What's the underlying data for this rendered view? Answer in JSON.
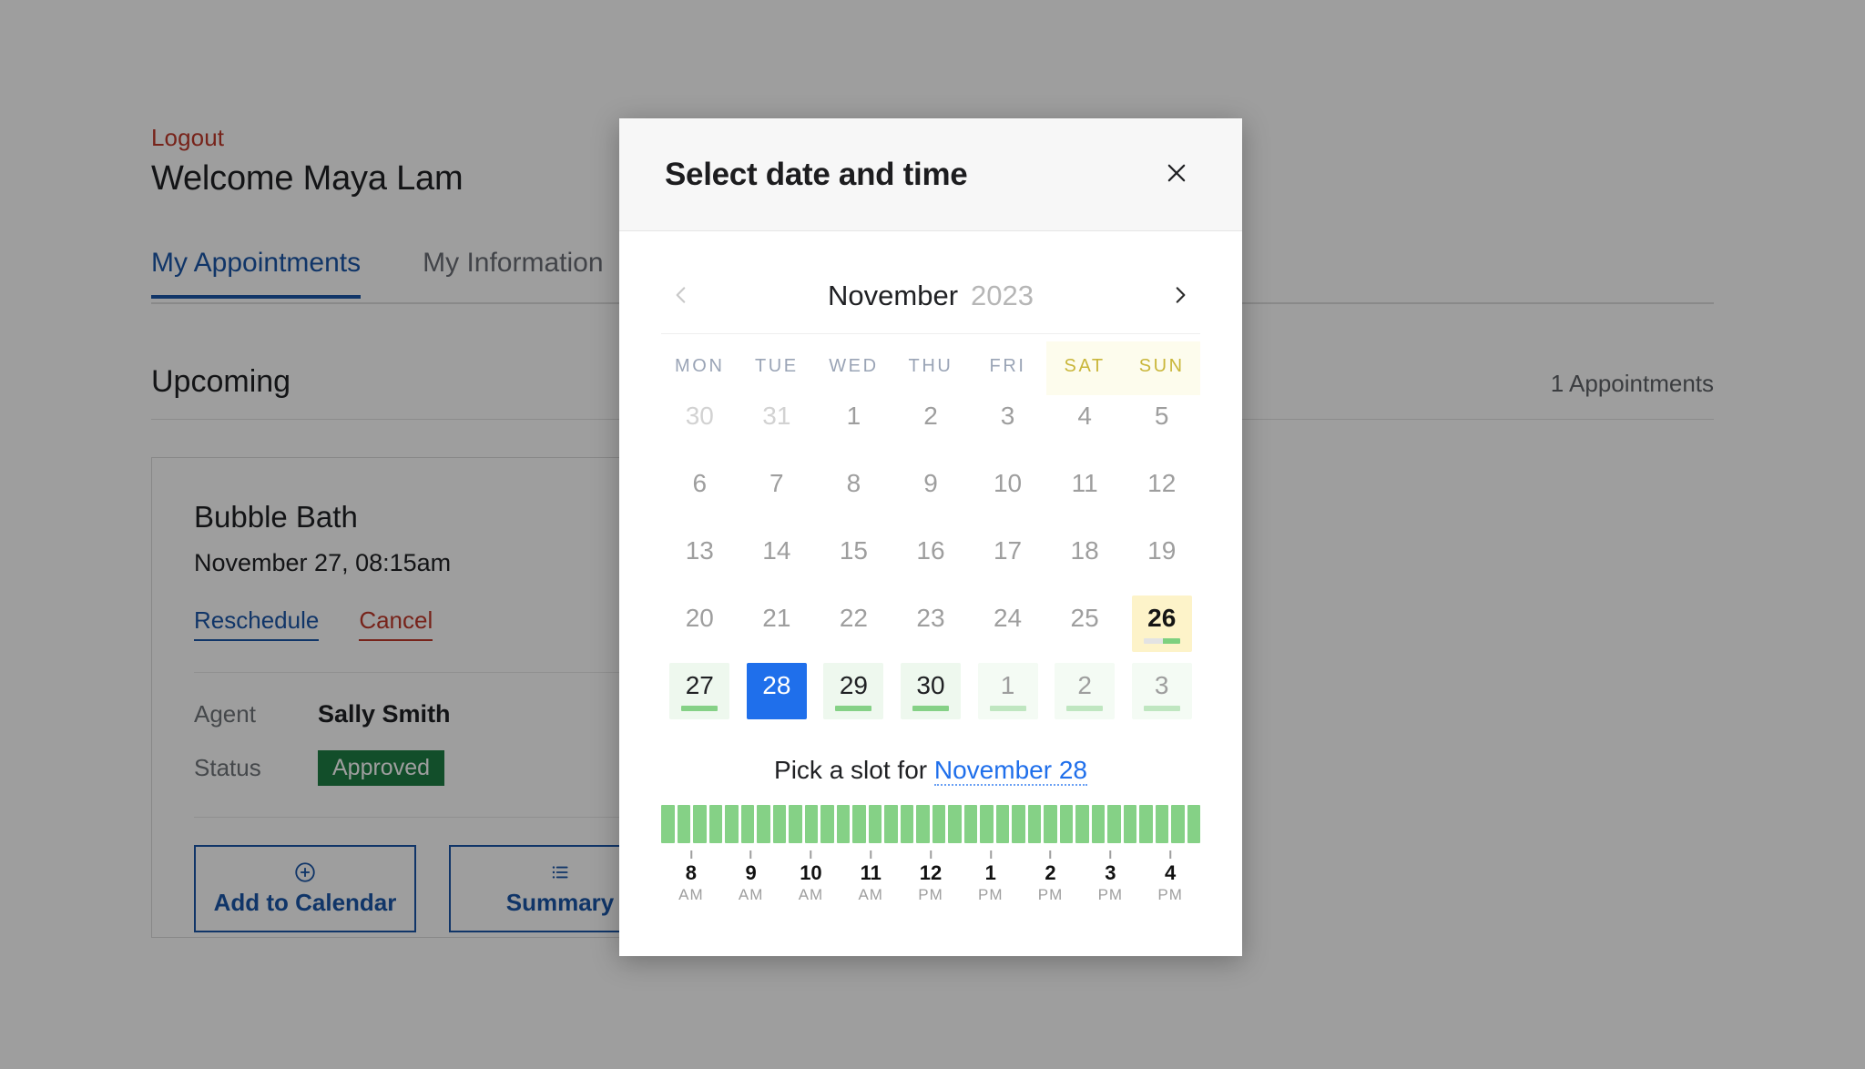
{
  "page": {
    "logout_label": "Logout",
    "welcome_title": "Welcome Maya Lam",
    "tabs": [
      {
        "label": "My Appointments",
        "active": true
      },
      {
        "label": "My Information",
        "active": false
      }
    ],
    "section": {
      "title": "Upcoming",
      "count_label": "1 Appointments"
    },
    "appointment": {
      "name": "Bubble Bath",
      "datetime": "November 27, 08:15am",
      "reschedule_label": "Reschedule",
      "cancel_label": "Cancel",
      "agent_label": "Agent",
      "agent_value": "Sally Smith",
      "status_label": "Status",
      "status_value": "Approved",
      "status_color": "#1e7e44",
      "add_to_calendar_label": "Add to Calendar",
      "add_to_calendar_icon": "plus-circle-icon",
      "summary_label": "Summary",
      "summary_icon": "list-icon"
    },
    "accent_color": "#1a56a8",
    "danger_color": "#c0392b"
  },
  "modal": {
    "title": "Select date and time",
    "close_icon": "close-icon",
    "prev_icon": "chevron-left-icon",
    "next_icon": "chevron-right-icon",
    "month_name": "November",
    "year": "2023",
    "weekdays": [
      {
        "label": "MON",
        "weekend": false
      },
      {
        "label": "TUE",
        "weekend": false
      },
      {
        "label": "WED",
        "weekend": false
      },
      {
        "label": "THU",
        "weekend": false
      },
      {
        "label": "FRI",
        "weekend": false
      },
      {
        "label": "SAT",
        "weekend": true
      },
      {
        "label": "SUN",
        "weekend": true
      }
    ],
    "weeks": [
      [
        {
          "day": "30",
          "state": "muted"
        },
        {
          "day": "31",
          "state": "muted"
        },
        {
          "day": "1",
          "state": "past"
        },
        {
          "day": "2",
          "state": "past"
        },
        {
          "day": "3",
          "state": "past"
        },
        {
          "day": "4",
          "state": "past"
        },
        {
          "day": "5",
          "state": "past"
        }
      ],
      [
        {
          "day": "6",
          "state": "past"
        },
        {
          "day": "7",
          "state": "past"
        },
        {
          "day": "8",
          "state": "past"
        },
        {
          "day": "9",
          "state": "past"
        },
        {
          "day": "10",
          "state": "past"
        },
        {
          "day": "11",
          "state": "past"
        },
        {
          "day": "12",
          "state": "past"
        }
      ],
      [
        {
          "day": "13",
          "state": "past"
        },
        {
          "day": "14",
          "state": "past"
        },
        {
          "day": "15",
          "state": "past"
        },
        {
          "day": "16",
          "state": "past"
        },
        {
          "day": "17",
          "state": "past"
        },
        {
          "day": "18",
          "state": "past"
        },
        {
          "day": "19",
          "state": "past"
        }
      ],
      [
        {
          "day": "20",
          "state": "past"
        },
        {
          "day": "21",
          "state": "past"
        },
        {
          "day": "22",
          "state": "past"
        },
        {
          "day": "23",
          "state": "past"
        },
        {
          "day": "24",
          "state": "past"
        },
        {
          "day": "25",
          "state": "past"
        },
        {
          "day": "26",
          "state": "today",
          "bar": "partial"
        }
      ],
      [
        {
          "day": "27",
          "state": "avail",
          "bar": "full"
        },
        {
          "day": "28",
          "state": "selected"
        },
        {
          "day": "29",
          "state": "avail",
          "bar": "full"
        },
        {
          "day": "30",
          "state": "avail",
          "bar": "full"
        },
        {
          "day": "1",
          "state": "avail-next",
          "bar": "light"
        },
        {
          "day": "2",
          "state": "avail-next",
          "bar": "light"
        },
        {
          "day": "3",
          "state": "avail-next",
          "bar": "light"
        }
      ]
    ],
    "slot_prompt_prefix": "Pick a slot for ",
    "slot_prompt_date": "November 28",
    "slot_count": 34,
    "slot_color": "#85d186",
    "axis_ticks": [
      {
        "hour": "8",
        "meridiem": "AM"
      },
      {
        "hour": "9",
        "meridiem": "AM"
      },
      {
        "hour": "10",
        "meridiem": "AM"
      },
      {
        "hour": "11",
        "meridiem": "AM"
      },
      {
        "hour": "12",
        "meridiem": "PM"
      },
      {
        "hour": "1",
        "meridiem": "PM"
      },
      {
        "hour": "2",
        "meridiem": "PM"
      },
      {
        "hour": "3",
        "meridiem": "PM"
      },
      {
        "hour": "4",
        "meridiem": "PM"
      }
    ]
  }
}
